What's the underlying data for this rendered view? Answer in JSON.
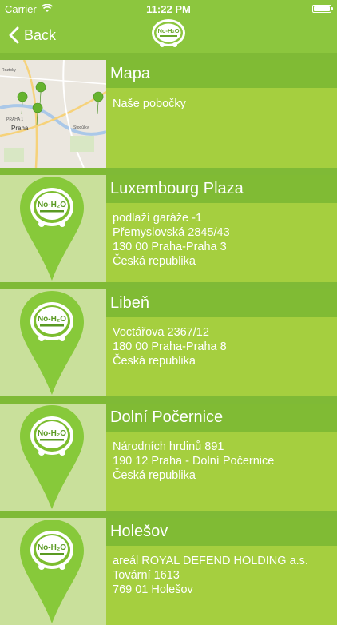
{
  "status": {
    "carrier": "Carrier",
    "time": "11:22 PM"
  },
  "nav": {
    "back_label": "Back",
    "logo_text": "No-H₂O"
  },
  "colors": {
    "bar": "#8cc63e",
    "row": "#a5cf3f",
    "title": "#80bb34",
    "thumb": "#c9e09b",
    "pin": "#87c93a"
  },
  "map_row": {
    "title": "Mapa",
    "subtitle": "Naše pobočky",
    "map_labels": {
      "city": "Praha",
      "district": "PRAHA 1",
      "top": "Roztoky",
      "right": "Stodůlky"
    }
  },
  "branches": [
    {
      "name": "Luxembourg Plaza",
      "lines": [
        "podlaží garáže -1",
        "Přemyslovská 2845/43",
        "130 00 Praha-Praha 3",
        "Česká republika"
      ]
    },
    {
      "name": "Libeň",
      "lines": [
        "Voctářova 2367/12",
        "180 00 Praha-Praha 8",
        "Česká republika"
      ]
    },
    {
      "name": "Dolní Počernice",
      "lines": [
        "Národních hrdinů 891",
        "190 12 Praha - Dolní Počernice",
        "Česká republika"
      ]
    },
    {
      "name": "Holešov",
      "lines": [
        "areál ROYAL DEFEND HOLDING a.s.",
        "Tovární 1613",
        "769 01 Holešov"
      ]
    }
  ]
}
